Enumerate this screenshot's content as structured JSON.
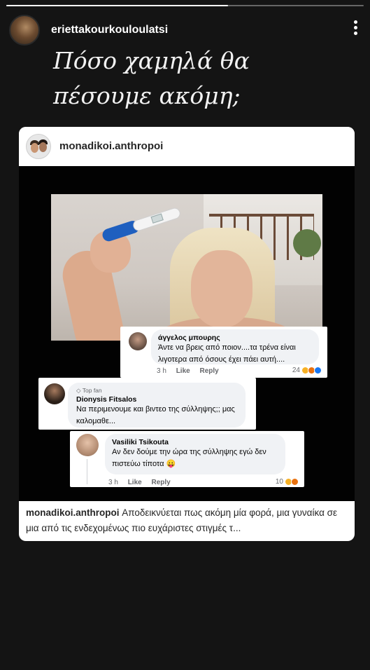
{
  "story": {
    "progress": 0.62,
    "username": "eriettakourkouloulatsi",
    "caption": "Πόσο χαμηλά θα πέσουμε ακόμη;"
  },
  "post": {
    "username": "monadikoi.anthropoi",
    "caption_user": "monadikoi.anthropoi",
    "caption_text": "Αποδεικνύεται πως ακόμη μία φορά, μια γυναίκα  σε μια από τις ενδεχομένως πιο ευχάριστες στιγμές τ..."
  },
  "comments": [
    {
      "name": "άγγελος μπουρης",
      "text": "Άντε να βρεις από ποιον....τα τρένα είναι λιγοτερα από όσους έχει πάει αυτή....",
      "time": "3 h",
      "like": "Like",
      "reply": "Reply",
      "reaction_count": "24"
    },
    {
      "badge": "Top fan",
      "name": "Dionysis Fitsalos",
      "text": "Να περιμενουμε και βιντεο της σύλληψης;; μας καλομαθε..."
    },
    {
      "name": "Vasiliki Tsikouta",
      "text": "Αν δεν δούμε την ώρα της σύλληψης εγώ δεν πιστεύω τίποτα 😛",
      "time": "3 h",
      "like": "Like",
      "reply": "Reply",
      "reaction_count": "10"
    }
  ],
  "colors": {
    "background": "#141414",
    "reaction_haha": "#f7b125",
    "reaction_love": "#f33e58",
    "reaction_like": "#1877f2"
  }
}
